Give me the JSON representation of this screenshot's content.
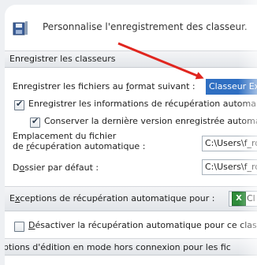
{
  "header": {
    "text": "Personnalise l'enregistrement des classeur.",
    "icon": "save-disk-icon"
  },
  "save_section": {
    "title": "Enregistrer les classeurs",
    "format": {
      "label_before": "Enregistrer les fichiers au ",
      "label_underlined": "f",
      "label_after": "ormat suivant :",
      "value": "Classeur Exc"
    },
    "autorecover_info": {
      "checked": true,
      "label": "Enregistrer les informations de récupération automa"
    },
    "keep_last_version": {
      "checked": true,
      "label": "Conserver la dernière version enregistrée automa"
    },
    "autorecover_location": {
      "label_line1": "Emplacement du fichier",
      "label_line2_before": "de ",
      "label_line2_underlined": "r",
      "label_line2_after": "écupération automatique :",
      "value": "C:\\Users\\f_ro"
    },
    "default_folder": {
      "label_before": "D",
      "label_underlined": "o",
      "label_after": "ssier par défaut :",
      "value": "C:\\Users\\f_ro"
    }
  },
  "exceptions_section": {
    "label_before": "E",
    "label_underlined": "x",
    "label_after": "ceptions de récupération automatique pour :",
    "workbook_value": "Cl",
    "workbook_icon": "excel-workbook-icon"
  },
  "disable_autorecover": {
    "checked": false,
    "label_underlined": "D",
    "label_after": "ésactiver la récupération automatique pour ce clas"
  },
  "offline_section": {
    "title": "ptions d'édition en mode hors connexion pour les fic"
  },
  "colors": {
    "accent_selection": "#2f6fc2",
    "arrow": "#e0261f"
  }
}
